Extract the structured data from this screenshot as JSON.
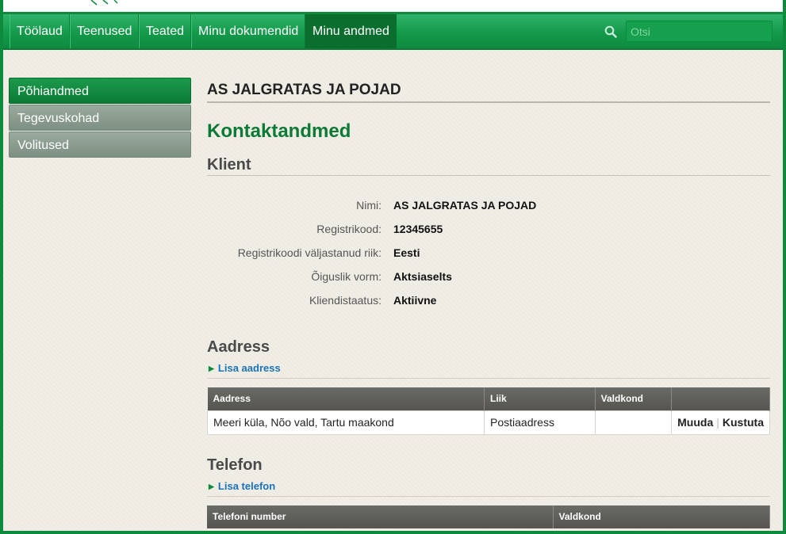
{
  "nav": {
    "items": [
      {
        "label": "Töölaud",
        "active": false
      },
      {
        "label": "Teenused",
        "active": false
      },
      {
        "label": "Teated",
        "active": false
      },
      {
        "label": "Minu dokumendid",
        "active": false
      },
      {
        "label": "Minu andmed",
        "active": true
      }
    ],
    "search": {
      "placeholder": "Otsi",
      "value": ""
    }
  },
  "sidenav": {
    "items": [
      {
        "label": "Põhiandmed",
        "active": true
      },
      {
        "label": "Tegevuskohad",
        "active": false
      },
      {
        "label": "Volitused",
        "active": false
      }
    ]
  },
  "main": {
    "company_name": "AS JALGRATAS JA POJAD",
    "page_title": "Kontaktandmed",
    "client": {
      "title": "Klient",
      "fields": [
        {
          "label": "Nimi:",
          "value": "AS JALGRATAS JA POJAD"
        },
        {
          "label": "Registrikood:",
          "value": "12345655"
        },
        {
          "label": "Registrikoodi väljastanud riik:",
          "value": "Eesti"
        },
        {
          "label": "Õiguslik vorm:",
          "value": "Aktsiaselts"
        },
        {
          "label": "Kliendistaatus:",
          "value": "Aktiivne"
        }
      ]
    },
    "address": {
      "title": "Aadress",
      "add_label": "Lisa aadress",
      "columns": [
        "Aadress",
        "Liik",
        "Valdkond",
        ""
      ],
      "rows": [
        {
          "address": "Meeri küla, Nõo vald, Tartu maakond",
          "type": "Postiaadress",
          "field": "",
          "edit_label": "Muuda",
          "delete_label": "Kustuta"
        }
      ]
    },
    "phone": {
      "title": "Telefon",
      "add_label": "Lisa telefon",
      "columns": [
        "Telefoni number",
        "Valdkond"
      ]
    }
  },
  "colors": {
    "brand_green": "#0d8a3c",
    "heading_green": "#0b7a35",
    "link_blue": "#1a72b8"
  }
}
